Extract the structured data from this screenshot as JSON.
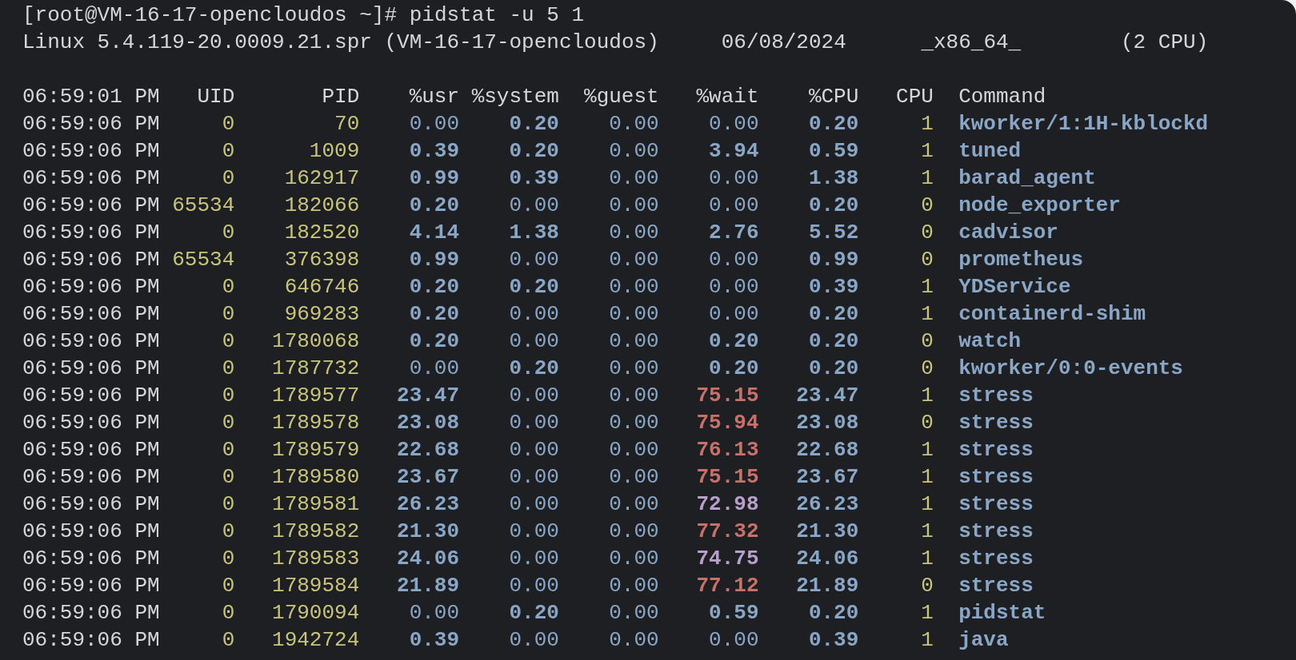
{
  "prompt": {
    "text": "[root@VM-16-17-opencloudos ~]# pidstat -u 5 1"
  },
  "system_info": {
    "kernel": "Linux 5.4.119-20.0009.21.spr (VM-16-17-opencloudos)",
    "date": "06/08/2024",
    "arch": "_x86_64_",
    "cpus": "(2 CPU)"
  },
  "table": {
    "columns": [
      "06:59:01 PM",
      "UID",
      "PID",
      "%usr",
      "%system",
      "%guest",
      "%wait",
      "%CPU",
      "CPU",
      "Command"
    ],
    "rows": [
      {
        "time": "06:59:06 PM",
        "uid": "0",
        "pid": "70",
        "usr": "0.00",
        "system": "0.20",
        "guest": "0.00",
        "wait": "0.00",
        "cpu_pct": "0.20",
        "cpu": "1",
        "command": "kworker/1:1H-kblockd"
      },
      {
        "time": "06:59:06 PM",
        "uid": "0",
        "pid": "1009",
        "usr": "0.39",
        "system": "0.20",
        "guest": "0.00",
        "wait": "3.94",
        "cpu_pct": "0.59",
        "cpu": "1",
        "command": "tuned"
      },
      {
        "time": "06:59:06 PM",
        "uid": "0",
        "pid": "162917",
        "usr": "0.99",
        "system": "0.39",
        "guest": "0.00",
        "wait": "0.00",
        "cpu_pct": "1.38",
        "cpu": "1",
        "command": "barad_agent"
      },
      {
        "time": "06:59:06 PM",
        "uid": "65534",
        "pid": "182066",
        "usr": "0.20",
        "system": "0.00",
        "guest": "0.00",
        "wait": "0.00",
        "cpu_pct": "0.20",
        "cpu": "0",
        "command": "node_exporter"
      },
      {
        "time": "06:59:06 PM",
        "uid": "0",
        "pid": "182520",
        "usr": "4.14",
        "system": "1.38",
        "guest": "0.00",
        "wait": "2.76",
        "cpu_pct": "5.52",
        "cpu": "0",
        "command": "cadvisor"
      },
      {
        "time": "06:59:06 PM",
        "uid": "65534",
        "pid": "376398",
        "usr": "0.99",
        "system": "0.00",
        "guest": "0.00",
        "wait": "0.00",
        "cpu_pct": "0.99",
        "cpu": "0",
        "command": "prometheus"
      },
      {
        "time": "06:59:06 PM",
        "uid": "0",
        "pid": "646746",
        "usr": "0.20",
        "system": "0.20",
        "guest": "0.00",
        "wait": "0.00",
        "cpu_pct": "0.39",
        "cpu": "1",
        "command": "YDService"
      },
      {
        "time": "06:59:06 PM",
        "uid": "0",
        "pid": "969283",
        "usr": "0.20",
        "system": "0.00",
        "guest": "0.00",
        "wait": "0.00",
        "cpu_pct": "0.20",
        "cpu": "1",
        "command": "containerd-shim"
      },
      {
        "time": "06:59:06 PM",
        "uid": "0",
        "pid": "1780068",
        "usr": "0.20",
        "system": "0.00",
        "guest": "0.00",
        "wait": "0.20",
        "cpu_pct": "0.20",
        "cpu": "0",
        "command": "watch"
      },
      {
        "time": "06:59:06 PM",
        "uid": "0",
        "pid": "1787732",
        "usr": "0.00",
        "system": "0.20",
        "guest": "0.00",
        "wait": "0.20",
        "cpu_pct": "0.20",
        "cpu": "0",
        "command": "kworker/0:0-events"
      },
      {
        "time": "06:59:06 PM",
        "uid": "0",
        "pid": "1789577",
        "usr": "23.47",
        "system": "0.00",
        "guest": "0.00",
        "wait": "75.15",
        "color": "#c8716b",
        "cpu_pct": "23.47",
        "cpu": "1",
        "command": "stress"
      },
      {
        "time": "06:59:06 PM",
        "uid": "0",
        "pid": "1789578",
        "usr": "23.08",
        "system": "0.00",
        "guest": "0.00",
        "wait": "75.94",
        "color": "#c8716b",
        "cpu_pct": "23.08",
        "cpu": "0",
        "command": "stress"
      },
      {
        "time": "06:59:06 PM",
        "uid": "0",
        "pid": "1789579",
        "usr": "22.68",
        "system": "0.00",
        "guest": "0.00",
        "wait": "76.13",
        "color": "#c8716b",
        "cpu_pct": "22.68",
        "cpu": "1",
        "command": "stress"
      },
      {
        "time": "06:59:06 PM",
        "uid": "0",
        "pid": "1789580",
        "usr": "23.67",
        "system": "0.00",
        "guest": "0.00",
        "wait": "75.15",
        "color": "#c8716b",
        "cpu_pct": "23.67",
        "cpu": "1",
        "command": "stress"
      },
      {
        "time": "06:59:06 PM",
        "uid": "0",
        "pid": "1789581",
        "usr": "26.23",
        "system": "0.00",
        "guest": "0.00",
        "wait": "72.98",
        "color": "#b7a0cb",
        "cpu_pct": "26.23",
        "cpu": "1",
        "command": "stress"
      },
      {
        "time": "06:59:06 PM",
        "uid": "0",
        "pid": "1789582",
        "usr": "21.30",
        "system": "0.00",
        "guest": "0.00",
        "wait": "77.32",
        "color": "#c8716b",
        "cpu_pct": "21.30",
        "cpu": "1",
        "command": "stress"
      },
      {
        "time": "06:59:06 PM",
        "uid": "0",
        "pid": "1789583",
        "usr": "24.06",
        "system": "0.00",
        "guest": "0.00",
        "wait": "74.75",
        "color": "#b7a0cb",
        "cpu_pct": "24.06",
        "cpu": "1",
        "command": "stress"
      },
      {
        "time": "06:59:06 PM",
        "uid": "0",
        "pid": "1789584",
        "usr": "21.89",
        "system": "0.00",
        "guest": "0.00",
        "wait": "77.12",
        "color": "#c8716b",
        "cpu_pct": "21.89",
        "cpu": "0",
        "command": "stress"
      },
      {
        "time": "06:59:06 PM",
        "uid": "0",
        "pid": "1790094",
        "usr": "0.00",
        "system": "0.20",
        "guest": "0.00",
        "wait": "0.59",
        "cpu_pct": "0.20",
        "cpu": "1",
        "command": "pidstat"
      },
      {
        "time": "06:59:06 PM",
        "uid": "0",
        "pid": "1942724",
        "usr": "0.39",
        "system": "0.00",
        "guest": "0.00",
        "wait": "0.00",
        "cpu_pct": "0.39",
        "cpu": "1",
        "command": "java"
      }
    ]
  }
}
